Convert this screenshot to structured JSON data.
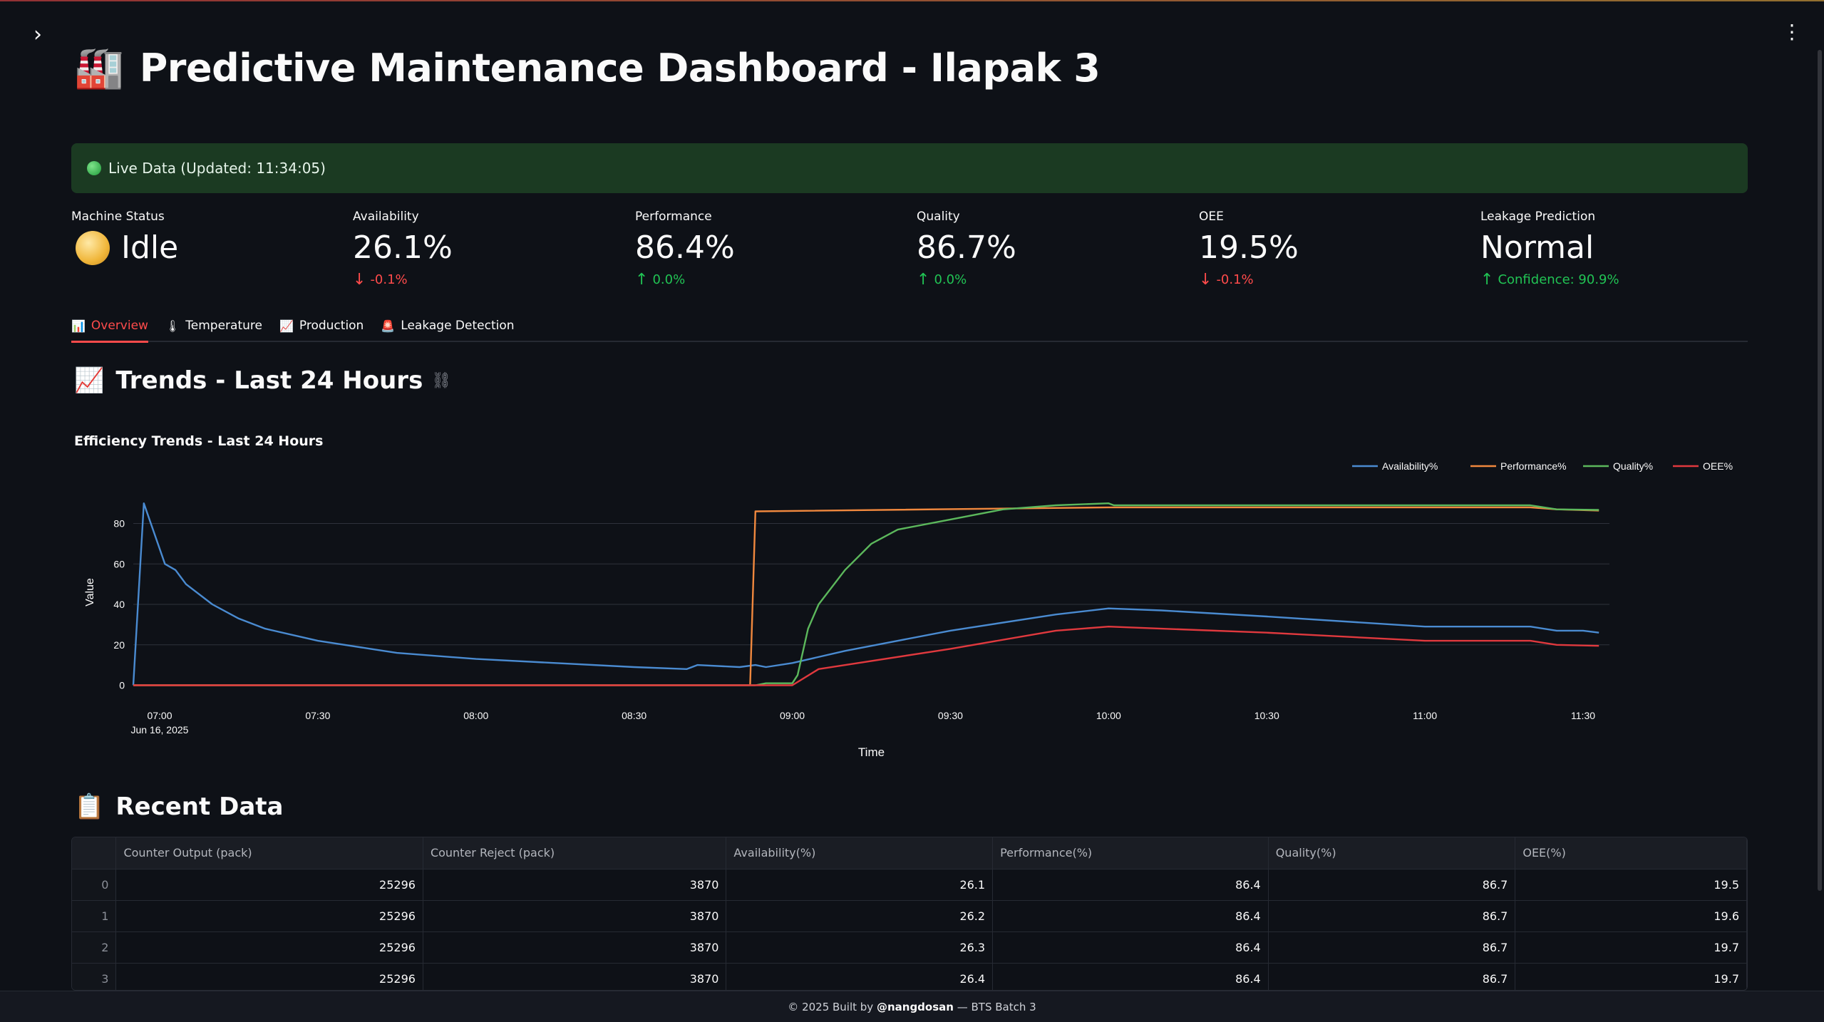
{
  "header": {
    "title_emoji": "🏭",
    "title": "Predictive Maintenance Dashboard - Ilapak 3"
  },
  "live": {
    "text": "Live Data (Updated: 11:34:05)"
  },
  "metrics": {
    "machine_status": {
      "label": "Machine Status",
      "value": "Idle"
    },
    "availability": {
      "label": "Availability",
      "value": "26.1%",
      "delta": "-0.1%"
    },
    "performance": {
      "label": "Performance",
      "value": "86.4%",
      "delta": "0.0%"
    },
    "quality": {
      "label": "Quality",
      "value": "86.7%",
      "delta": "0.0%"
    },
    "oee": {
      "label": "OEE",
      "value": "19.5%",
      "delta": "-0.1%"
    },
    "leakage": {
      "label": "Leakage Prediction",
      "value": "Normal",
      "delta": "Confidence: 90.9%"
    }
  },
  "tabs": [
    {
      "icon": "📊",
      "label": "Overview"
    },
    {
      "icon": "🌡",
      "label": "Temperature"
    },
    {
      "icon": "📈",
      "label": "Production"
    },
    {
      "icon": "🚨",
      "label": "Leakage Detection"
    }
  ],
  "trends": {
    "emoji": "📈",
    "title": "Trends - Last 24 Hours",
    "link_icon": "⛓"
  },
  "recent": {
    "emoji": "📋",
    "title": "Recent Data"
  },
  "chart_data": {
    "type": "line",
    "title": "Efficiency Trends - Last 24 Hours",
    "xlabel": "Time",
    "ylabel": "Value",
    "x_ticks": [
      "07:00",
      "07:30",
      "08:00",
      "08:30",
      "09:00",
      "09:30",
      "10:00",
      "10:30",
      "11:00",
      "11:30"
    ],
    "x_date_label": "Jun 16, 2025",
    "y_ticks": [
      0,
      20,
      40,
      60,
      80
    ],
    "xlim_minutes_from_0700": [
      -5,
      275
    ],
    "ylim": [
      -3,
      95
    ],
    "legend_position": "top-right",
    "grid": true,
    "series": [
      {
        "name": "Availability%",
        "color": "#4a8bd1",
        "x": [
          "06:55",
          "06:57",
          "07:01",
          "07:03",
          "07:05",
          "07:10",
          "07:15",
          "07:20",
          "07:30",
          "07:40",
          "07:45",
          "08:00",
          "08:30",
          "08:40",
          "08:42",
          "08:50",
          "08:53",
          "08:55",
          "09:00",
          "09:10",
          "09:30",
          "09:50",
          "10:00",
          "10:10",
          "10:30",
          "11:00",
          "11:20",
          "11:25",
          "11:30",
          "11:33"
        ],
        "y": [
          0,
          90,
          60,
          57,
          50,
          40,
          33,
          28,
          22,
          18,
          16,
          13,
          9,
          8,
          10,
          9,
          10,
          9,
          11,
          17,
          27,
          35,
          38,
          37,
          34,
          29,
          29,
          27,
          27,
          26
        ]
      },
      {
        "name": "Performance%",
        "color": "#f0883e",
        "x": [
          "06:55",
          "08:52",
          "08:53",
          "10:00",
          "11:20",
          "11:25",
          "11:33"
        ],
        "y": [
          0,
          0,
          86,
          88,
          88,
          87,
          86.4
        ]
      },
      {
        "name": "Quality%",
        "color": "#5cb85c",
        "x": [
          "06:55",
          "08:53",
          "08:55",
          "09:00",
          "09:01",
          "09:03",
          "09:05",
          "09:10",
          "09:15",
          "09:20",
          "09:30",
          "09:40",
          "09:50",
          "10:00",
          "10:01",
          "11:20",
          "11:25",
          "11:33"
        ],
        "y": [
          0,
          0,
          1,
          1,
          5,
          28,
          40,
          57,
          70,
          77,
          82,
          87,
          89,
          90,
          89,
          89,
          87,
          86.7
        ]
      },
      {
        "name": "OEE%",
        "color": "#e0393e",
        "x": [
          "06:55",
          "09:00",
          "09:05",
          "09:30",
          "09:50",
          "10:00",
          "10:30",
          "11:00",
          "11:20",
          "11:25",
          "11:33"
        ],
        "y": [
          0,
          0,
          8,
          18,
          27,
          29,
          26,
          22,
          22,
          20,
          19.5
        ]
      }
    ]
  },
  "table": {
    "columns": [
      "",
      "Counter Output (pack)",
      "Counter Reject (pack)",
      "Availability(%)",
      "Performance(%)",
      "Quality(%)",
      "OEE(%)"
    ],
    "rows": [
      [
        "0",
        "25296",
        "3870",
        "26.1",
        "86.4",
        "86.7",
        "19.5"
      ],
      [
        "1",
        "25296",
        "3870",
        "26.2",
        "86.4",
        "86.7",
        "19.6"
      ],
      [
        "2",
        "25296",
        "3870",
        "26.3",
        "86.4",
        "86.7",
        "19.7"
      ],
      [
        "3",
        "25296",
        "3870",
        "26.4",
        "86.4",
        "86.7",
        "19.7"
      ]
    ]
  },
  "footer": {
    "prefix": "© 2025 Built by ",
    "author": "@nangdosan",
    "suffix": " — BTS Batch 3"
  }
}
